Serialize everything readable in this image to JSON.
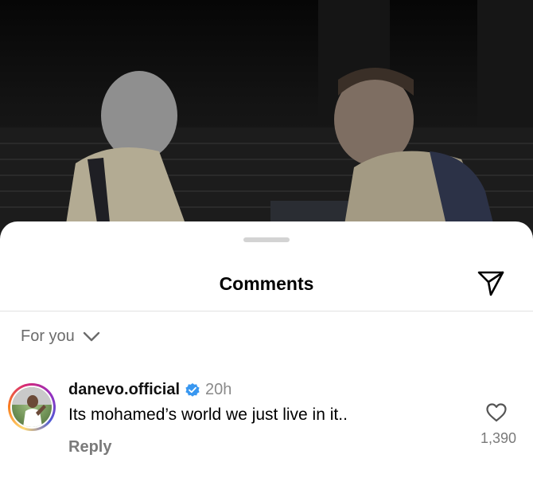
{
  "sheet": {
    "title": "Comments",
    "filter_label": "For you"
  },
  "comment": {
    "username": "danevo.official",
    "verified": true,
    "time": "20h",
    "text": "Its mohamed’s world we just live in it..",
    "reply_label": "Reply",
    "like_count": "1,390"
  },
  "icons": {
    "share": "send-icon",
    "filter": "chevron-down-icon",
    "verified": "verified-badge-icon",
    "like": "heart-icon"
  },
  "colors": {
    "verified_blue": "#3897f0",
    "muted_text": "#7a7a7a"
  }
}
